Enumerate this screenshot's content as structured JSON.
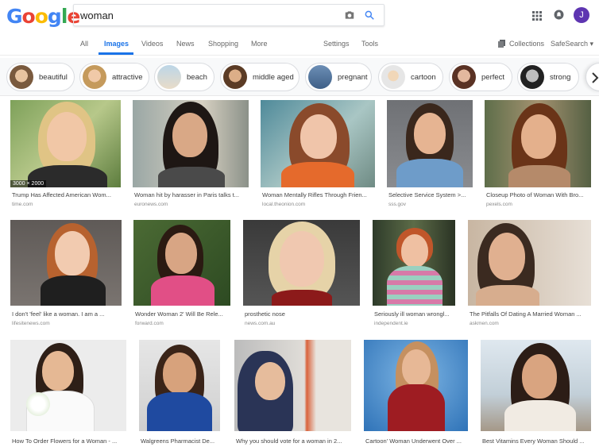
{
  "header": {
    "logo": "Google",
    "search_value": "woman",
    "avatar_letter": "J"
  },
  "tabs": {
    "all": "All",
    "images": "Images",
    "videos": "Videos",
    "news": "News",
    "shopping": "Shopping",
    "more": "More",
    "settings": "Settings",
    "tools": "Tools",
    "collections": "Collections",
    "safesearch": "SafeSearch ▾"
  },
  "chips": [
    {
      "label": "beautiful",
      "color": "#c8a07c"
    },
    {
      "label": "attractive",
      "color": "#d6b48a"
    },
    {
      "label": "beach",
      "color": "#e7d8c3"
    },
    {
      "label": "middle aged",
      "color": "#8a6448"
    },
    {
      "label": "pregnant",
      "color": "#5d7fa5"
    },
    {
      "label": "cartoon",
      "color": "#e7e0d8"
    },
    {
      "label": "perfect",
      "color": "#b07f68"
    },
    {
      "label": "strong",
      "color": "#3c3c3c"
    }
  ],
  "results": [
    {
      "caption": "Trump Has Affected American Wom...",
      "source": "time.com",
      "dims": "3000 × 2000"
    },
    {
      "caption": "Woman hit by harasser in Paris talks t...",
      "source": "euronews.com"
    },
    {
      "caption": "Woman Mentally Rifles Through Frien...",
      "source": "local.theonion.com"
    },
    {
      "caption": "Selective Service System >...",
      "source": "sss.gov"
    },
    {
      "caption": "Closeup Photo of Woman With Bro...",
      "source": "pexels.com"
    },
    {
      "caption": "I don't 'feel' like a woman. I am a ...",
      "source": "lifesitenews.com"
    },
    {
      "caption": "Wonder Woman 2' Will Be Rele...",
      "source": "forward.com"
    },
    {
      "caption": "prosthetic nose",
      "source": "news.com.au"
    },
    {
      "caption": "Seriously ill woman wrongl...",
      "source": "independent.ie"
    },
    {
      "caption": "The Pitfalls Of Dating A Married Woman ...",
      "source": "askmen.com"
    },
    {
      "caption": "How To Order Flowers for a Woman - ...",
      "source": ""
    },
    {
      "caption": "Walgreens Pharmacist De...",
      "source": ""
    },
    {
      "caption": "Why you should vote for a woman in 2...",
      "source": ""
    },
    {
      "caption": "Cartoon' Woman Underwent Over ...",
      "source": ""
    },
    {
      "caption": "Best Vitamins Every Woman Should ...",
      "source": ""
    }
  ]
}
